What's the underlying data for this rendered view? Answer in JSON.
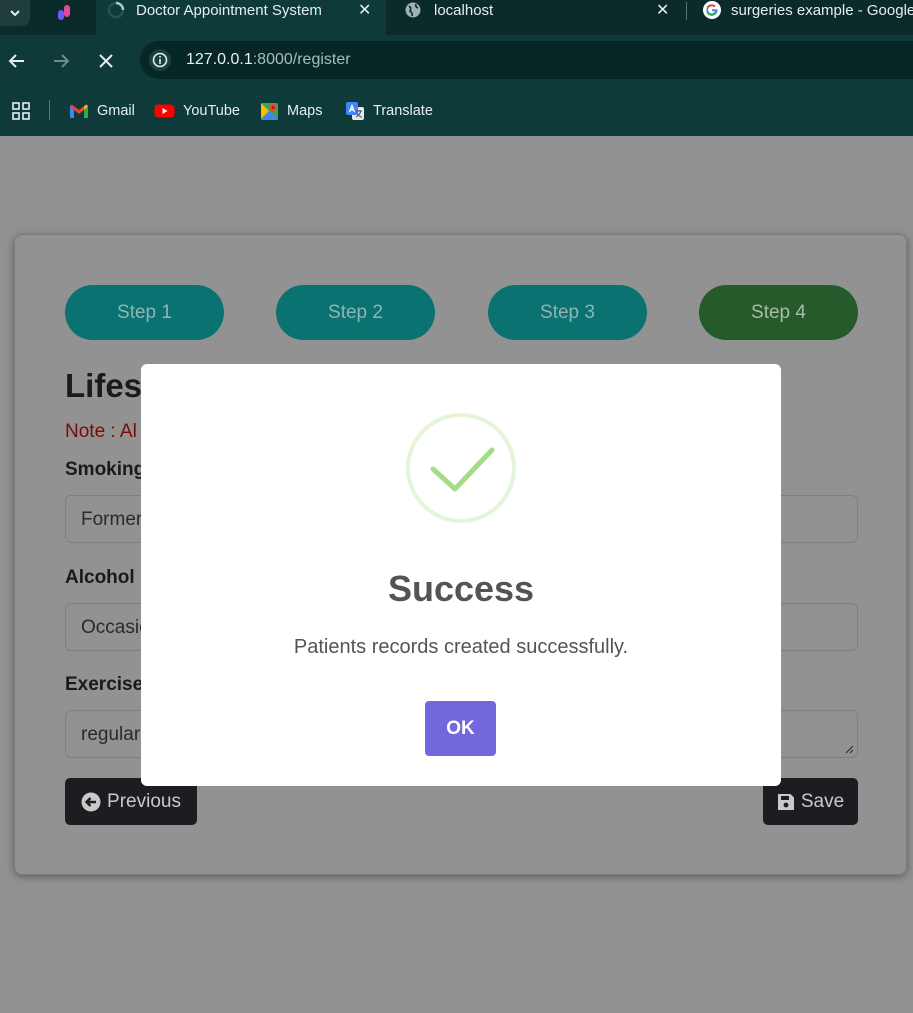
{
  "browser": {
    "tabs": [
      {
        "title": "Doctor Appointment System",
        "active": true,
        "loading": true
      },
      {
        "title": "localhost",
        "active": false
      },
      {
        "title": "surgeries example - Google",
        "active": false
      }
    ],
    "close_glyph": "✕",
    "url": {
      "host": "127.0.0.1",
      "rest": ":8000/register"
    },
    "bookmarks": [
      {
        "label": "Gmail",
        "icon": "gmail-icon"
      },
      {
        "label": "YouTube",
        "icon": "youtube-icon"
      },
      {
        "label": "Maps",
        "icon": "maps-icon"
      },
      {
        "label": "Translate",
        "icon": "translate-icon"
      }
    ]
  },
  "form": {
    "steps": [
      {
        "label": "Step 1",
        "active": false
      },
      {
        "label": "Step 2",
        "active": false
      },
      {
        "label": "Step 3",
        "active": false
      },
      {
        "label": "Step 4",
        "active": true
      }
    ],
    "heading": "Lifest",
    "note": "Note : Al",
    "fields": [
      {
        "label": "Smoking",
        "value": "Former"
      },
      {
        "label": "Alcohol",
        "value": "Occasio"
      },
      {
        "label": "Exercise",
        "value": "regular"
      }
    ],
    "previous_label": "Previous",
    "save_label": "Save"
  },
  "modal": {
    "title": "Success",
    "message": "Patients records created successfully.",
    "ok_label": "OK"
  },
  "colors": {
    "step": "#0b7272",
    "step_active": "#255a2a",
    "ok_button": "#7367de",
    "check": "#a5dc86",
    "browser_frame": "#0e3a3a"
  }
}
